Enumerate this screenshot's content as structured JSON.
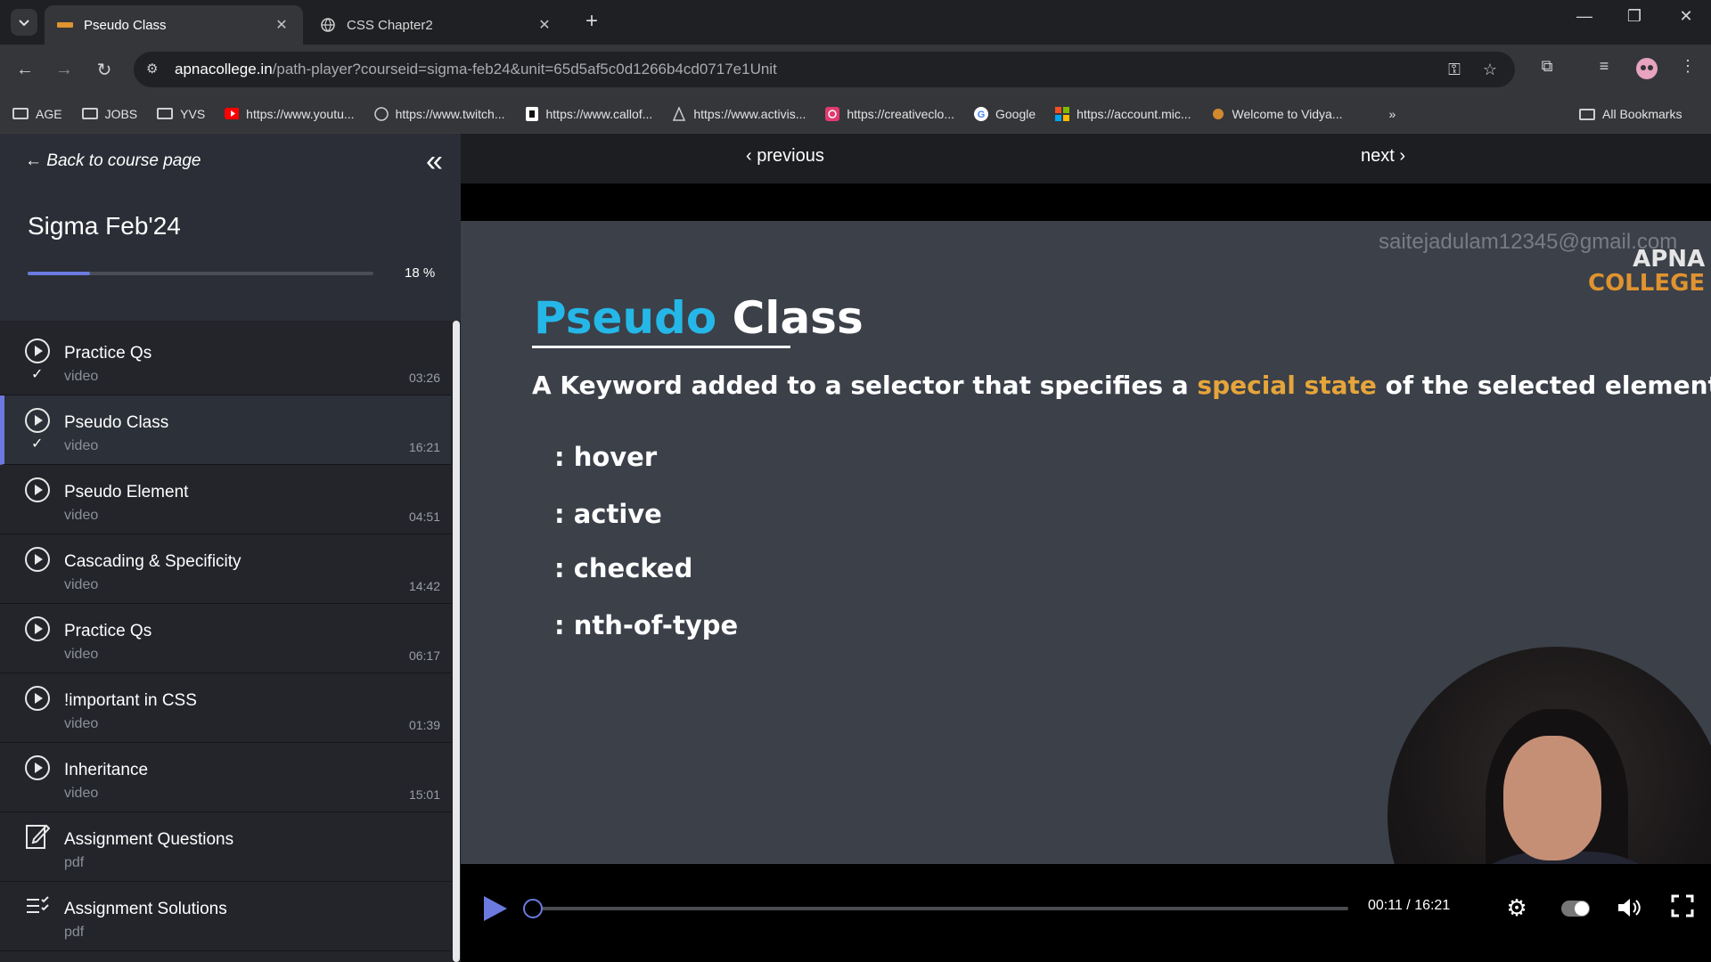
{
  "browser": {
    "tabs": [
      {
        "title": "Pseudo Class",
        "active": true
      },
      {
        "title": "CSS Chapter2",
        "active": false
      }
    ],
    "url_host": "apnacollege.in",
    "url_path": "/path-player?courseid=sigma-feb24&unit=65d5af5c0d1266b4cd0717e1Unit",
    "bookmarks": [
      {
        "label": "AGE",
        "icon": "folder-icon"
      },
      {
        "label": "JOBS",
        "icon": "folder-icon"
      },
      {
        "label": "YVS",
        "icon": "folder-icon"
      },
      {
        "label": "https://www.youtu...",
        "icon": "youtube-icon"
      },
      {
        "label": "https://www.twitch...",
        "icon": "globe-icon"
      },
      {
        "label": "https://www.callof...",
        "icon": "callofduty-icon"
      },
      {
        "label": "https://www.activis...",
        "icon": "activision-icon"
      },
      {
        "label": "https://creativeclo...",
        "icon": "creativecloud-icon"
      },
      {
        "label": "Google",
        "icon": "google-icon"
      },
      {
        "label": "https://account.mic...",
        "icon": "microsoft-icon"
      },
      {
        "label": "Welcome to Vidya...",
        "icon": "vidya-icon"
      }
    ],
    "all_bookmarks": "All Bookmarks"
  },
  "sidebar": {
    "back_label": "Back to course page",
    "course_title": "Sigma Feb'24",
    "progress_percent": 18,
    "progress_label": "18 %",
    "lessons": [
      {
        "title": "Practice Qs",
        "type": "video",
        "duration": "03:26",
        "done": true,
        "icon": "play-circle-icon"
      },
      {
        "title": "Pseudo Class",
        "type": "video",
        "duration": "16:21",
        "done": true,
        "current": true,
        "icon": "play-circle-icon"
      },
      {
        "title": "Pseudo Element",
        "type": "video",
        "duration": "04:51",
        "done": false,
        "icon": "play-circle-icon"
      },
      {
        "title": "Cascading & Specificity",
        "type": "video",
        "duration": "14:42",
        "done": false,
        "icon": "play-circle-icon"
      },
      {
        "title": "Practice Qs",
        "type": "video",
        "duration": "06:17",
        "done": false,
        "icon": "play-circle-icon"
      },
      {
        "title": "!important in CSS",
        "type": "video",
        "duration": "01:39",
        "done": false,
        "icon": "play-circle-icon"
      },
      {
        "title": "Inheritance",
        "type": "video",
        "duration": "15:01",
        "done": false,
        "icon": "play-circle-icon"
      },
      {
        "title": "Assignment Questions",
        "type": "pdf",
        "duration": "",
        "done": false,
        "icon": "edit-doc-icon"
      },
      {
        "title": "Assignment Solutions",
        "type": "pdf",
        "duration": "",
        "done": false,
        "icon": "checklist-icon"
      }
    ]
  },
  "player": {
    "previous_label": "previous",
    "next_label": "next",
    "slide": {
      "watermark": "saitejadulam12345@gmail.com",
      "logo_line1": "APNA",
      "logo_line2": "COLLEGE",
      "title_part1": "Pseudo",
      "title_part2": "Class",
      "definition_pre": "A Keyword added to a selector that specifies a ",
      "definition_highlight": "special state",
      "definition_post": " of the selected element(s)",
      "items": [
        ": hover",
        ": active",
        ": checked",
        ": nth-of-type"
      ]
    },
    "time_label": "00:11 / 16:21",
    "elapsed_fraction": 0.011,
    "accent_color": "#6c7ae0"
  }
}
